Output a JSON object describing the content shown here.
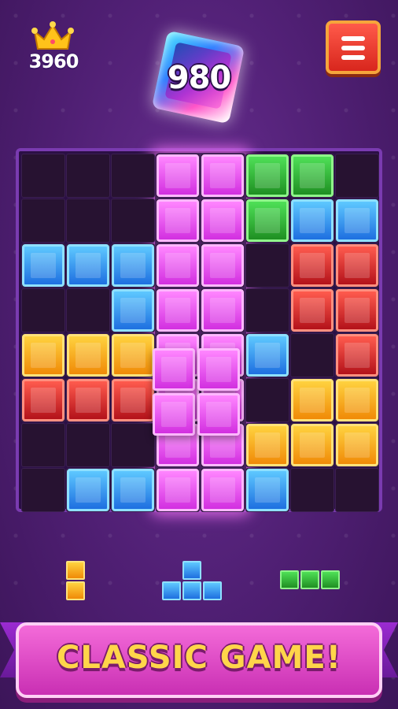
{
  "header": {
    "best_score": "3960",
    "current_score": "980",
    "crown_icon": "crown-icon",
    "gem_icon": "gem-icon",
    "menu_icon": "menu-icon"
  },
  "colors": {
    "blue": "#2f8cf0",
    "red": "#e0241f",
    "green": "#2fb832",
    "orange": "#f7a81a",
    "pink": "#ef5af2",
    "board_empty": "#271231"
  },
  "board": {
    "rows": 8,
    "cols": 8,
    "grid": [
      [
        ".",
        ".",
        ".",
        "P",
        "P",
        "G",
        "G",
        "."
      ],
      [
        ".",
        ".",
        ".",
        "P",
        "P",
        "G",
        "B",
        "B"
      ],
      [
        "B",
        "B",
        "B",
        "P",
        "P",
        ".",
        "R",
        "R"
      ],
      [
        ".",
        ".",
        "B",
        "P",
        "P",
        ".",
        "R",
        "R"
      ],
      [
        "O",
        "O",
        "O",
        "P",
        "P",
        "B",
        ".",
        "R"
      ],
      [
        "R",
        "R",
        "R",
        "P",
        "P",
        ".",
        "O",
        "O"
      ],
      [
        ".",
        ".",
        ".",
        "P",
        "P",
        "O",
        "O",
        "O"
      ],
      [
        ".",
        "B",
        "B",
        "P",
        "P",
        "B",
        ".",
        "."
      ]
    ],
    "cleared_columns": [
      3,
      4
    ],
    "dragging_piece": {
      "color": "P",
      "shape": "square-2x2"
    }
  },
  "pieces_tray": [
    {
      "name": "orange-vertical-2",
      "color": "O",
      "cells": [
        [
          0,
          0
        ],
        [
          1,
          0
        ]
      ]
    },
    {
      "name": "blue-t-piece",
      "color": "B",
      "cells": [
        [
          0,
          1
        ],
        [
          1,
          0
        ],
        [
          1,
          1
        ],
        [
          1,
          2
        ]
      ]
    },
    {
      "name": "green-horizontal-3",
      "color": "G",
      "cells": [
        [
          0,
          0
        ],
        [
          0,
          1
        ],
        [
          0,
          2
        ]
      ]
    }
  ],
  "banner": {
    "text": "CLASSIC GAME!"
  }
}
